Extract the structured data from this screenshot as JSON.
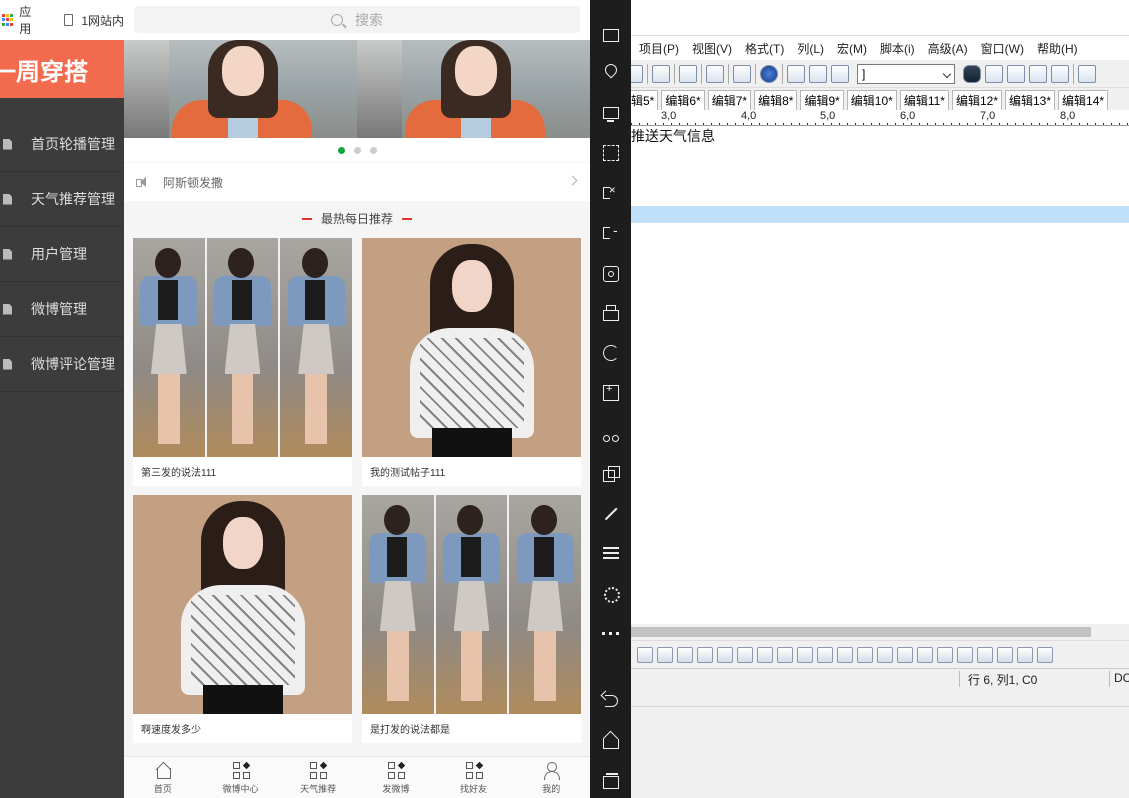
{
  "browser": {
    "apps_label": "应用",
    "tab_label": "1网站内"
  },
  "admin": {
    "brand": "一周穿搭",
    "menu": [
      {
        "label": "首页轮播管理"
      },
      {
        "label": "天气推荐管理"
      },
      {
        "label": "用户管理"
      },
      {
        "label": "微博管理"
      },
      {
        "label": "微博评论管理"
      }
    ]
  },
  "phone": {
    "search_placeholder": "搜索",
    "notice": "阿斯顿发撒",
    "section_title": "最热每日推荐",
    "posts": [
      {
        "caption": "第三发的说法111",
        "image": "collage"
      },
      {
        "caption": "我的测试帖子111",
        "image": "portrait"
      },
      {
        "caption": "啊速度发多少",
        "image": "portrait"
      },
      {
        "caption": "是打发的说法都是",
        "image": "collage"
      }
    ],
    "tabs": [
      {
        "label": "首页",
        "icon": "home-icon"
      },
      {
        "label": "微博中心",
        "icon": "grid-icon"
      },
      {
        "label": "天气推荐",
        "icon": "grid-icon"
      },
      {
        "label": "发微博",
        "icon": "grid-icon"
      },
      {
        "label": "找好友",
        "icon": "grid-icon"
      },
      {
        "label": "我的",
        "icon": "user-icon"
      }
    ],
    "colors": {
      "accent": "#f36b4f",
      "dot_active": "#15a23f",
      "section_dash": "#e0312b"
    }
  },
  "editor": {
    "menus": [
      "项目(P)",
      "视图(V)",
      "格式(T)",
      "列(L)",
      "宏(M)",
      "脚本(i)",
      "高级(A)",
      "窗口(W)",
      "帮助(H)"
    ],
    "combo_value": "]",
    "tabs": [
      "辑5*",
      "编辑6*",
      "编辑7*",
      "编辑8*",
      "编辑9*",
      "编辑10*",
      "编辑11*",
      "编辑12*",
      "编辑13*",
      "编辑14*"
    ],
    "ruler": [
      "3,0",
      "4,0",
      "5,0",
      "6,0",
      "7,0",
      "8,0"
    ],
    "text_line": "推送天气信息",
    "status_position": "行 6, 列1, C0",
    "status_encoding": "DC"
  }
}
